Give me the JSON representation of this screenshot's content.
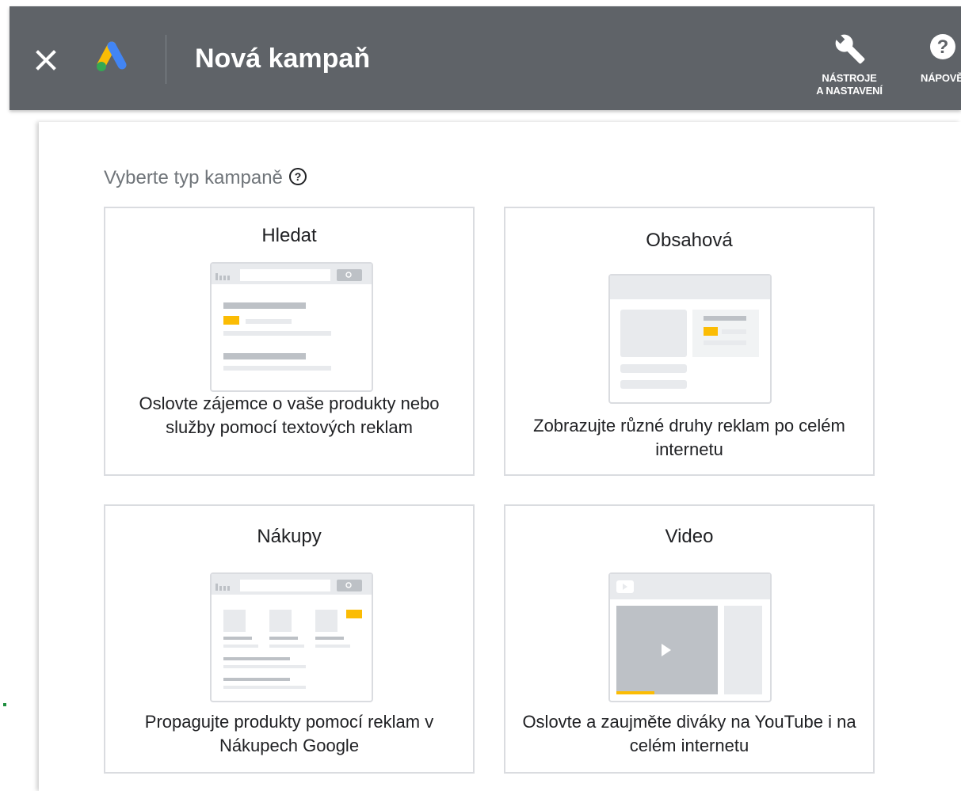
{
  "header": {
    "title": "Nová kampaň",
    "tools_line1": "NÁSTROJE",
    "tools_line2": "A NASTAVENÍ",
    "help_label": "NÁPOVĚDA"
  },
  "main": {
    "heading": "Vyberte typ kampaně"
  },
  "campaign_types": [
    {
      "title": "Hledat",
      "description": "Oslovte zájemce o vaše produkty nebo služby pomocí textových reklam"
    },
    {
      "title": "Obsahová",
      "description": "Zobrazujte různé druhy reklam po celém internetu"
    },
    {
      "title": "Nákupy",
      "description": "Propagujte produkty pomocí reklam v Nákupech Google"
    },
    {
      "title": "Video",
      "description": "Oslovte a zaujměte diváky na YouTube i na celém internetu"
    }
  ],
  "colors": {
    "topbar": "#5f6368",
    "accent": "#fbbc04",
    "card_border": "#dadce0",
    "placeholder": "#e8eaed"
  },
  "icons": [
    "close-icon",
    "google-ads-logo",
    "wrench-icon",
    "help-icon",
    "help-outline-icon",
    "play-icon"
  ]
}
